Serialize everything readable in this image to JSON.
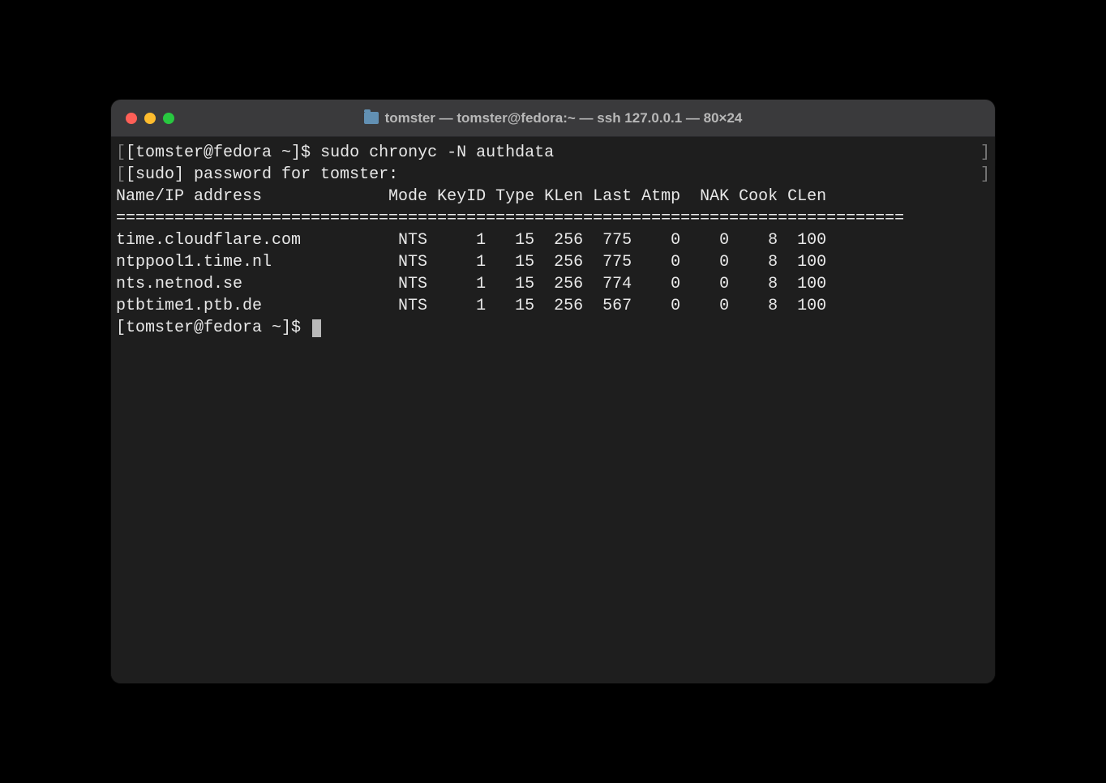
{
  "window": {
    "title": "tomster — tomster@fedora:~ — ssh 127.0.0.1 — 80×24"
  },
  "terminal": {
    "prompt1": "[tomster@fedora ~]$ ",
    "command": "sudo chronyc -N authdata",
    "sudo_prompt": "[sudo] password for tomster:",
    "header": "Name/IP address             Mode KeyID Type KLen Last Atmp  NAK Cook CLen",
    "separator": "=================================================================================",
    "rows": [
      "time.cloudflare.com          NTS     1   15  256  775    0    0    8  100",
      "ntppool1.time.nl             NTS     1   15  256  775    0    0    8  100",
      "nts.netnod.se                NTS     1   15  256  774    0    0    8  100",
      "ptbtime1.ptb.de              NTS     1   15  256  567    0    0    8  100"
    ],
    "prompt2": "[tomster@fedora ~]$ "
  }
}
